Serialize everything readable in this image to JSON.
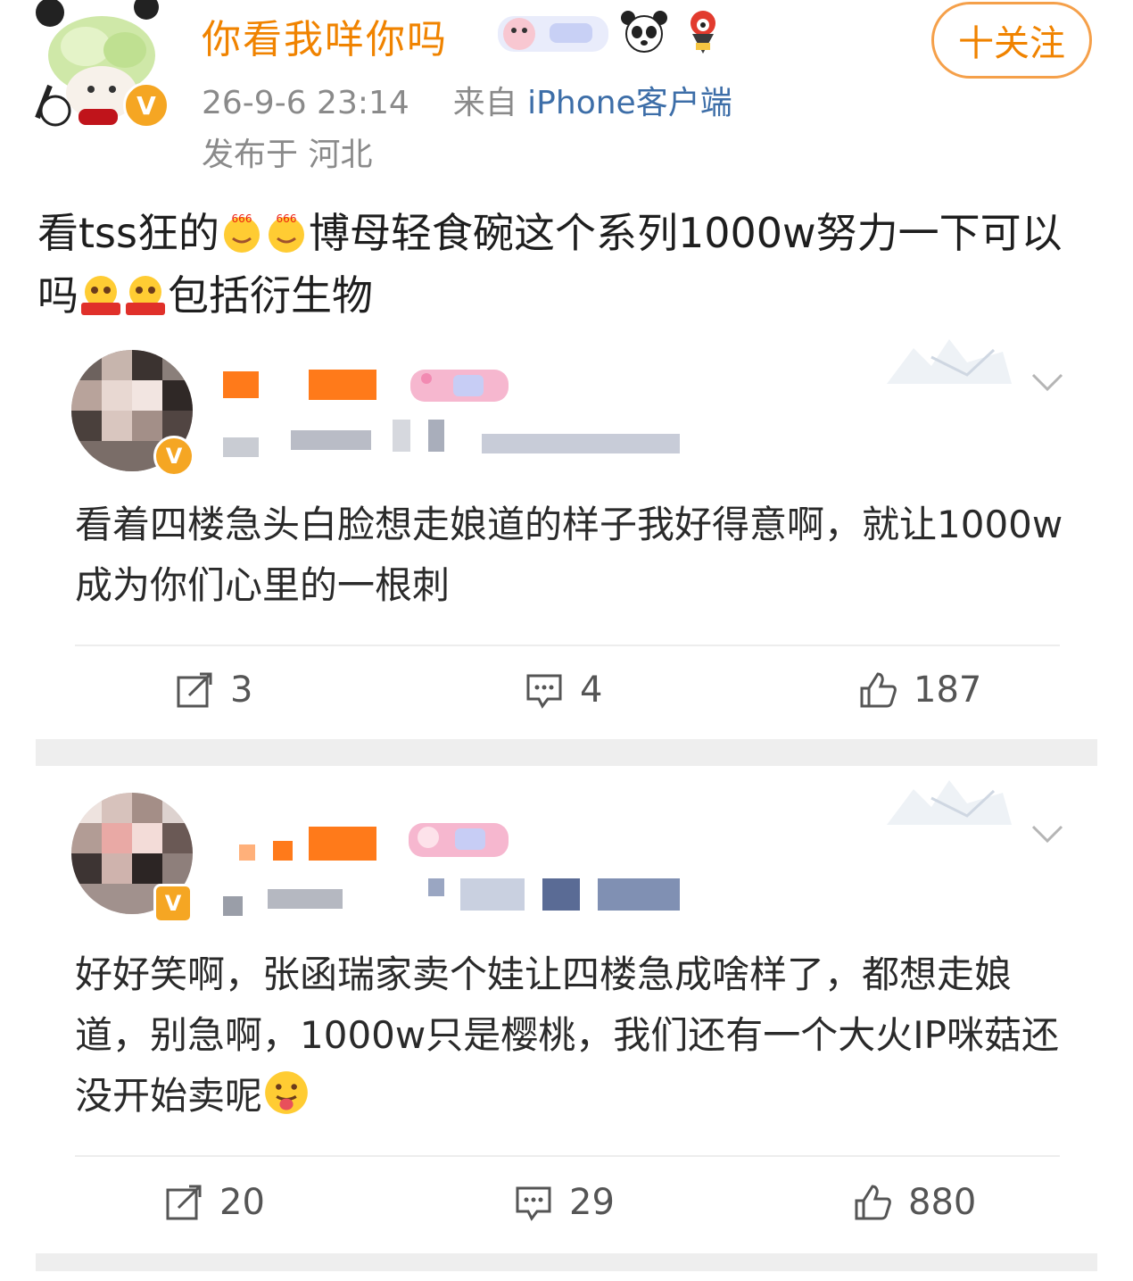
{
  "post": {
    "username": "你看我咩你吗",
    "follow_label": "十关注",
    "timestamp": "26-9-6 23:14",
    "from_label": "来自",
    "source": "iPhone客户端",
    "location": "发布于 河北",
    "text_parts": [
      "看tss狂的",
      "博母轻食碗这个系列1000w努力一下可以吗",
      "包括衍生物"
    ]
  },
  "comments": [
    {
      "text": "看着四楼急头白脸想走娘道的样子我好得意啊，就让1000w成为你们心里的一根刺",
      "reposts": "3",
      "replies": "4",
      "likes": "187"
    },
    {
      "text": "好好笑啊，张函瑞家卖个娃让四楼急成啥样了，都想走娘道，别急啊，1000w只是樱桃，我们还有一个大火IP咪菇还没开始卖呢",
      "reposts": "20",
      "replies": "29",
      "likes": "880"
    }
  ],
  "icons": {
    "repost": "repost-icon",
    "comment": "comment-icon",
    "like": "like-icon",
    "chevron": "chevron-down-icon",
    "verified": "verified-badge-icon"
  },
  "colors": {
    "username": "#f08300",
    "source_link": "#3d6ea8",
    "meta": "#8a8a8a",
    "verified": "#f5a623"
  }
}
